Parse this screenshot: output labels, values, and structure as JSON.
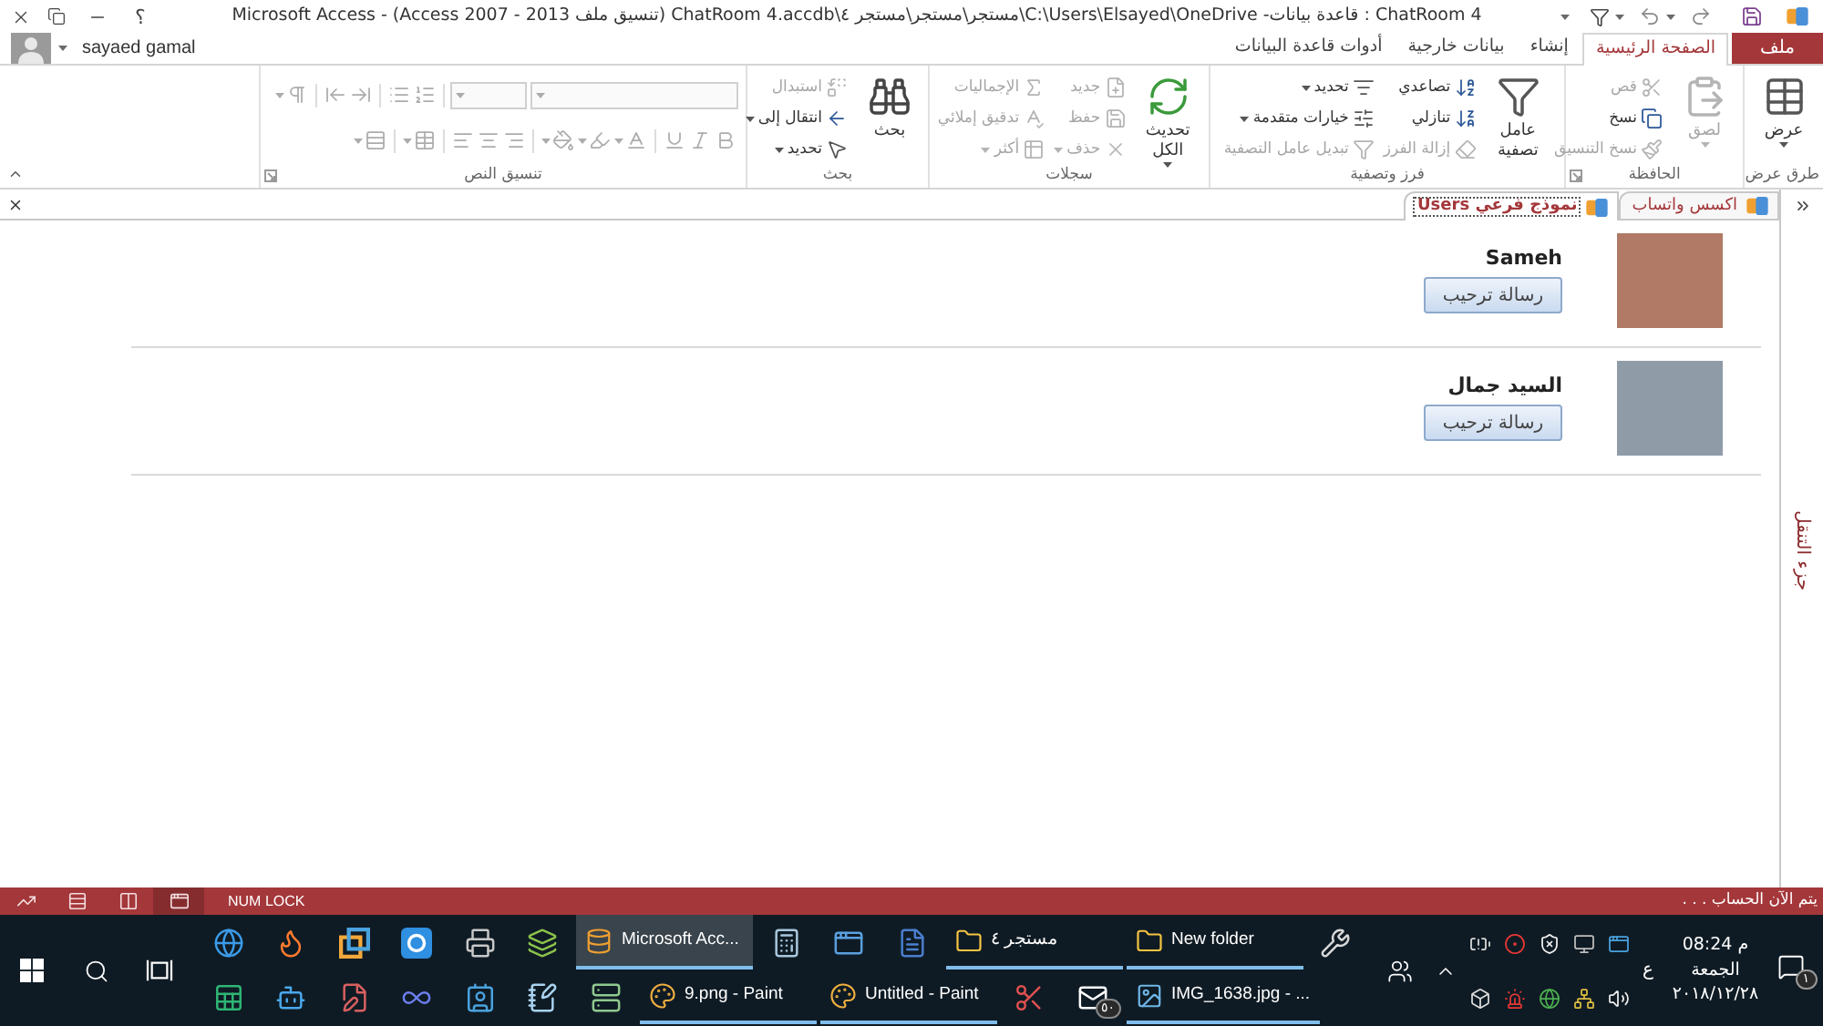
{
  "title_bar": {
    "help": "؟",
    "title": "ChatRoom 4 : قاعدة بيانات- C:\\Users\\Elsayed\\OneDrive\\مستجر\\مستجر\\مستجر ٤\\ChatRoom 4.accdb (تنسيق ملف Access 2007 - 2013) - Microsoft Access"
  },
  "account": {
    "name": "sayaed gamal"
  },
  "ribbon_tabs": [
    {
      "label": "ملف",
      "kind": "file",
      "selected": false
    },
    {
      "label": "الصفحة الرئيسية",
      "kind": "tab",
      "selected": true
    },
    {
      "label": "إنشاء",
      "kind": "tab",
      "selected": false
    },
    {
      "label": "بيانات خارجية",
      "kind": "tab",
      "selected": false
    },
    {
      "label": "أدوات قاعدة البيانات",
      "kind": "tab",
      "selected": false
    }
  ],
  "ribbon_groups": [
    {
      "kind": "buttons",
      "label": "طرق عرض",
      "large": [
        {
          "label": "عرض",
          "disabled": false,
          "dropdown": true
        }
      ]
    },
    {
      "kind": "buttons",
      "label": "الحافظة",
      "launcher": true,
      "large": [
        {
          "label": "لصق",
          "disabled": true,
          "dropdown": true
        }
      ],
      "columns": [
        [
          {
            "label": "قص",
            "disabled": true,
            "dropdown": false
          },
          {
            "label": "نسخ",
            "disabled": false,
            "dropdown": false
          },
          {
            "label": "نسخ التنسيق",
            "disabled": true,
            "dropdown": false
          }
        ]
      ]
    },
    {
      "kind": "buttons",
      "label": "فرز وتصفية",
      "large": [
        {
          "label": "عامل تصفية",
          "disabled": false,
          "dropdown": false
        }
      ],
      "columns": [
        [
          {
            "label": "تصاعدي",
            "disabled": false,
            "dropdown": false
          },
          {
            "label": "تنازلي",
            "disabled": false,
            "dropdown": false
          },
          {
            "label": "إزالة الفرز",
            "disabled": true,
            "dropdown": false
          }
        ],
        [
          {
            "label": "تحديد",
            "disabled": false,
            "dropdown": true
          },
          {
            "label": "خيارات متقدمة",
            "disabled": false,
            "dropdown": true
          },
          {
            "label": "تبديل عامل التصفية",
            "disabled": true,
            "dropdown": false
          }
        ]
      ]
    },
    {
      "kind": "buttons",
      "label": "سجلات",
      "large": [
        {
          "label": "تحديث الكل",
          "disabled": false,
          "dropdown": true
        }
      ],
      "columns": [
        [
          {
            "label": "جديد",
            "disabled": true,
            "dropdown": false
          },
          {
            "label": "حفظ",
            "disabled": true,
            "dropdown": false
          },
          {
            "label": "حذف",
            "disabled": true,
            "dropdown": true
          }
        ],
        [
          {
            "label": "الإجماليات",
            "disabled": true,
            "dropdown": false
          },
          {
            "label": "تدقيق إملائي",
            "disabled": true,
            "dropdown": false
          },
          {
            "label": "أكثر",
            "disabled": true,
            "dropdown": true
          }
        ]
      ]
    },
    {
      "kind": "buttons",
      "label": "بحث",
      "large": [
        {
          "label": "بحث",
          "disabled": false,
          "dropdown": false
        }
      ],
      "columns": [
        [
          {
            "label": "استبدال",
            "disabled": true,
            "dropdown": false
          },
          {
            "label": "انتقال إلى",
            "disabled": false,
            "dropdown": true
          },
          {
            "label": "تحديد",
            "disabled": false,
            "dropdown": true
          }
        ]
      ]
    },
    {
      "kind": "text_format",
      "label": "تنسيق النص",
      "launcher": true,
      "disabled": true
    }
  ],
  "document_tabs": [
    {
      "label": "اكسس واتساب",
      "selected": false
    },
    {
      "label": "نموذج فرعي Users",
      "selected": true
    }
  ],
  "navigation_pane": {
    "label": "جزء التنقل"
  },
  "form": {
    "records": [
      {
        "name": "Sameh",
        "button": "رسالة ترحيب"
      },
      {
        "name": "السيد جمال",
        "button": "رسالة ترحيب"
      }
    ]
  },
  "status_bar": {
    "views": [
      {
        "selected": false
      },
      {
        "selected": false
      },
      {
        "selected": false
      },
      {
        "selected": true
      }
    ],
    "indicator": "NUM LOCK",
    "message": "يتم الآن الحساب . . ."
  },
  "taskbar": {
    "top_row": [
      {
        "kind": "pinned"
      },
      {
        "kind": "window",
        "label": "New folder",
        "selected": false
      },
      {
        "kind": "window",
        "label": "مستجر ٤",
        "selected": false
      },
      {
        "kind": "pinned"
      },
      {
        "kind": "pinned"
      },
      {
        "kind": "pinned"
      },
      {
        "kind": "window",
        "label": "Microsoft Acc...",
        "selected": true
      },
      {
        "kind": "pinned"
      },
      {
        "kind": "pinned"
      },
      {
        "kind": "pinned"
      },
      {
        "kind": "pinned"
      },
      {
        "kind": "pinned"
      },
      {
        "kind": "pinned"
      }
    ],
    "bottom_row": [
      {
        "kind": "window",
        "label": "IMG_1638.jpg - ...",
        "selected": false
      },
      {
        "kind": "pinned",
        "badge": "٥٠"
      },
      {
        "kind": "pinned"
      },
      {
        "kind": "window",
        "label": "Untitled - Paint",
        "selected": false
      },
      {
        "kind": "window",
        "label": "9.png - Paint",
        "selected": false
      },
      {
        "kind": "pinned"
      },
      {
        "kind": "pinned"
      },
      {
        "kind": "pinned"
      },
      {
        "kind": "pinned"
      },
      {
        "kind": "pinned"
      },
      {
        "kind": "pinned"
      },
      {
        "kind": "pinned"
      }
    ],
    "tray": {
      "input_language": "ع",
      "clock": {
        "time": "م 08:24",
        "day": "الجمعة",
        "date": "٢٠١٨/١٢/٢٨"
      },
      "notification_badge": "١"
    }
  }
}
